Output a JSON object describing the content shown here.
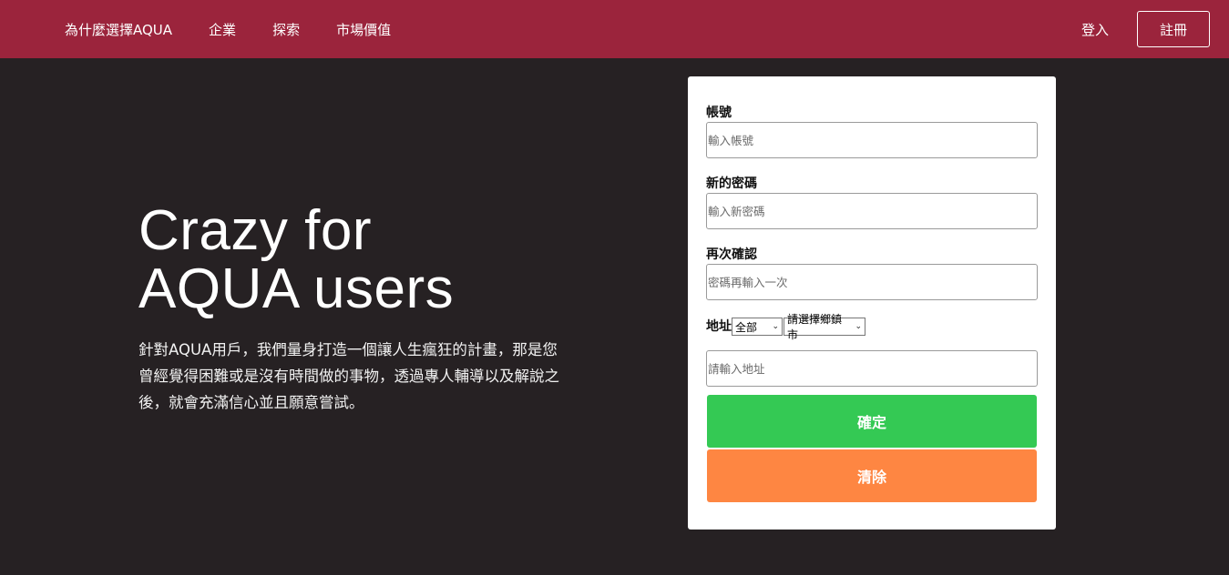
{
  "nav": {
    "links": [
      "為什麼選擇AQUA",
      "企業",
      "探索",
      "市場價值"
    ],
    "login": "登入",
    "register": "註冊"
  },
  "hero": {
    "title_line1": "Crazy for",
    "title_line2": "AQUA users",
    "description": "針對AQUA用戶，我們量身打造一個讓人生瘋狂的計畫，那是您曾經覺得困難或是沒有時間做的事物，透過專人輔導以及解說之後，就會充滿信心並且願意嘗試。"
  },
  "form": {
    "account_label": "帳號",
    "account_placeholder": "輸入帳號",
    "new_password_label": "新的密碼",
    "new_password_placeholder": "輸入新密碼",
    "confirm_label": "再次確認",
    "confirm_placeholder": "密碼再輸入一次",
    "address_label": "地址",
    "city_select": "全部",
    "town_select": "請選擇鄉鎮市",
    "address_placeholder": "請輸入地址",
    "confirm_button": "確定",
    "clear_button": "清除"
  },
  "colors": {
    "navbar": "#9b243c",
    "background": "#262123",
    "confirm": "#34c954",
    "clear": "#fe8642"
  }
}
